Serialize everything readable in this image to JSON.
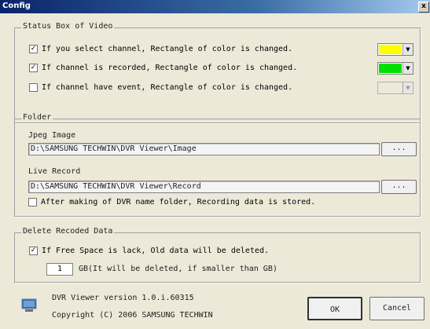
{
  "window": {
    "title": "Config",
    "close_glyph": "x"
  },
  "status_box": {
    "legend": "Status Box of Video",
    "options": [
      {
        "label": "If you select channel, Rectangle of color is changed.",
        "checked": true,
        "color": "#ffff00",
        "enabled": true
      },
      {
        "label": "If channel is recorded, Rectangle of color is changed.",
        "checked": true,
        "color": "#00e000",
        "enabled": true
      },
      {
        "label": "If channel have event, Rectangle of color is changed.",
        "checked": false,
        "color": "#ece9d8",
        "enabled": false
      }
    ],
    "dropdown_icon": "chevron-down-icon"
  },
  "folder": {
    "legend": "Folder",
    "jpeg_label": "Jpeg Image",
    "jpeg_path": "D:\\SAMSUNG TECHWIN\\DVR Viewer\\Image",
    "live_label": "Live Record",
    "live_path": "D:\\SAMSUNG TECHWIN\\DVR Viewer\\Record",
    "browse_label": "...",
    "name_folder_option": {
      "label": "After making of DVR name folder, Recording data is stored.",
      "checked": false
    }
  },
  "delete_data": {
    "legend": "Delete Recoded Data",
    "free_space_option": {
      "label": "If Free Space is lack, Old data will be deleted.",
      "checked": true
    },
    "gb_value": "1",
    "gb_label": "GB(It will be deleted, if smaller than GB)"
  },
  "footer": {
    "version": "DVR Viewer version 1.0.i.60315",
    "copyright": "Copyright (C) 2006 SAMSUNG TECHWIN",
    "ok_label": "OK",
    "cancel_label": "Cancel",
    "app_icon": "monitor-icon"
  },
  "colors": {
    "dialog_bg": "#ece9d8",
    "title_bar": "#0a246a"
  }
}
